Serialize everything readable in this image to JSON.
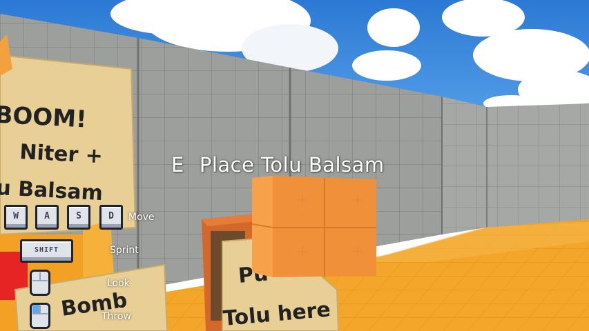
{
  "prompt": {
    "key": "E",
    "action": "Place Tolu Balsam"
  },
  "signs": {
    "left_sign_lines": [
      "BOOM!",
      "Niter +",
      "u Balsam"
    ],
    "crate_sign_lines": [
      "Pu",
      "Tolu here"
    ],
    "bomb_sign_lines": [
      "Bomb"
    ]
  },
  "controls": {
    "keys": [
      "W",
      "A",
      "S",
      "D"
    ],
    "shift_key": "SHIFT",
    "move_label": "Move",
    "sprint_label": "Sprint",
    "look_label": "Look",
    "throw_label": "Throw"
  },
  "icons": {
    "mouse_look": "mouse-move-icon",
    "mouse_throw": "mouse-left-click-icon"
  },
  "colors": {
    "sky": "#2f7fd9",
    "wall": "#9b9d9a",
    "floor": "#f2a423",
    "crate_block": "#f0913a",
    "sign_paper": "#e8cf95",
    "prompt_text": "#ffffff"
  }
}
